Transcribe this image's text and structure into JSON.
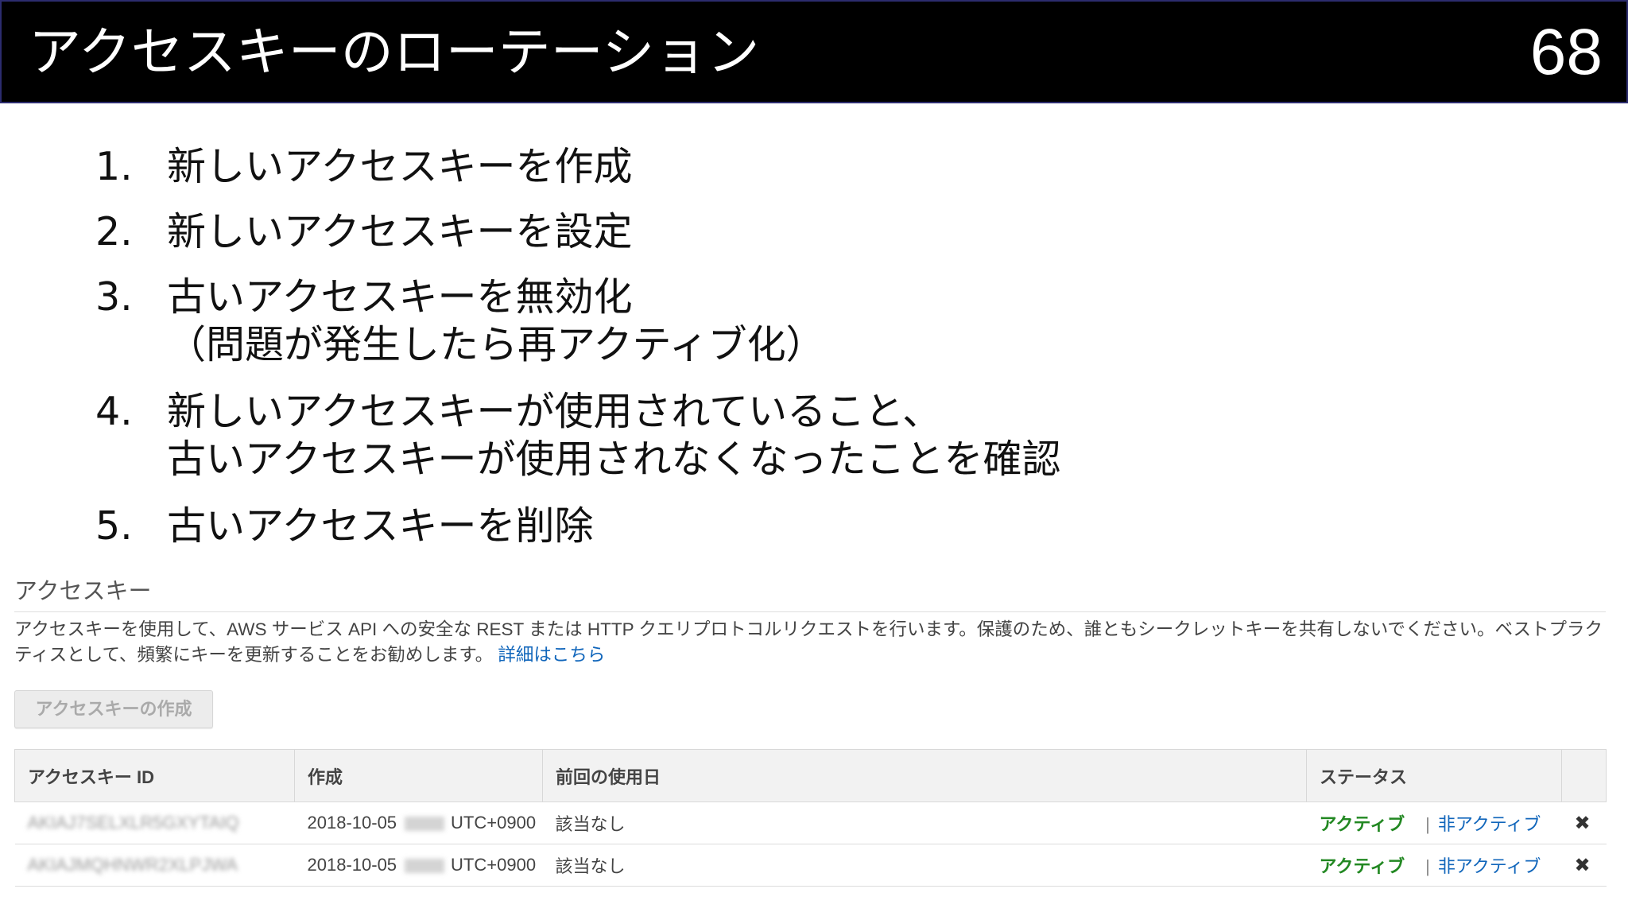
{
  "slide": {
    "title": "アクセスキーのローテーション",
    "page_number": "68"
  },
  "steps": [
    {
      "num": "1.",
      "lines": [
        "新しいアクセスキーを作成"
      ]
    },
    {
      "num": "2.",
      "lines": [
        "新しいアクセスキーを設定"
      ]
    },
    {
      "num": "3.",
      "lines": [
        "古いアクセスキーを無効化",
        "（問題が発生したら再アクティブ化）"
      ]
    },
    {
      "num": "4.",
      "lines": [
        "新しいアクセスキーが使用されていること、",
        "古いアクセスキーが使用されなくなったことを確認"
      ]
    },
    {
      "num": "5.",
      "lines": [
        "古いアクセスキーを削除"
      ]
    }
  ],
  "aws": {
    "heading": "アクセスキー",
    "description_line1": "アクセスキーを使用して、AWS サービス API への安全な REST または HTTP クエリプロトコルリクエストを行います。保護のため、誰ともシークレットキーを共有しないでください。ベストプラク",
    "description_line2": "ティスとして、頻繁にキーを更新することをお勧めします。",
    "details_link": "詳細はこちら",
    "create_button": "アクセスキーの作成",
    "columns": [
      "アクセスキー ID",
      "作成",
      "前回の使用日",
      "ステータス",
      ""
    ],
    "rows": [
      {
        "key_id": "AKIAJ7SELXLR5GXYTAIQ",
        "created_date": "2018-10-05",
        "created_time": "00:00",
        "created_tz": "UTC+0900",
        "last_used": "該当なし",
        "status_active": "アクティブ",
        "status_separator": "|",
        "status_inactive": "非アクティブ",
        "delete_glyph": "✖"
      },
      {
        "key_id": "AKIAJMQHNWR2XLPJWA",
        "created_date": "2018-10-05",
        "created_time": "00:00",
        "created_tz": "UTC+0900",
        "last_used": "該当なし",
        "status_active": "アクティブ",
        "status_separator": "|",
        "status_inactive": "非アクティブ",
        "delete_glyph": "✖"
      }
    ]
  },
  "icons": {
    "delete": "close-icon"
  },
  "colors": {
    "header_bg": "#000000",
    "active_green": "#228822",
    "link_blue": "#1166bb"
  }
}
